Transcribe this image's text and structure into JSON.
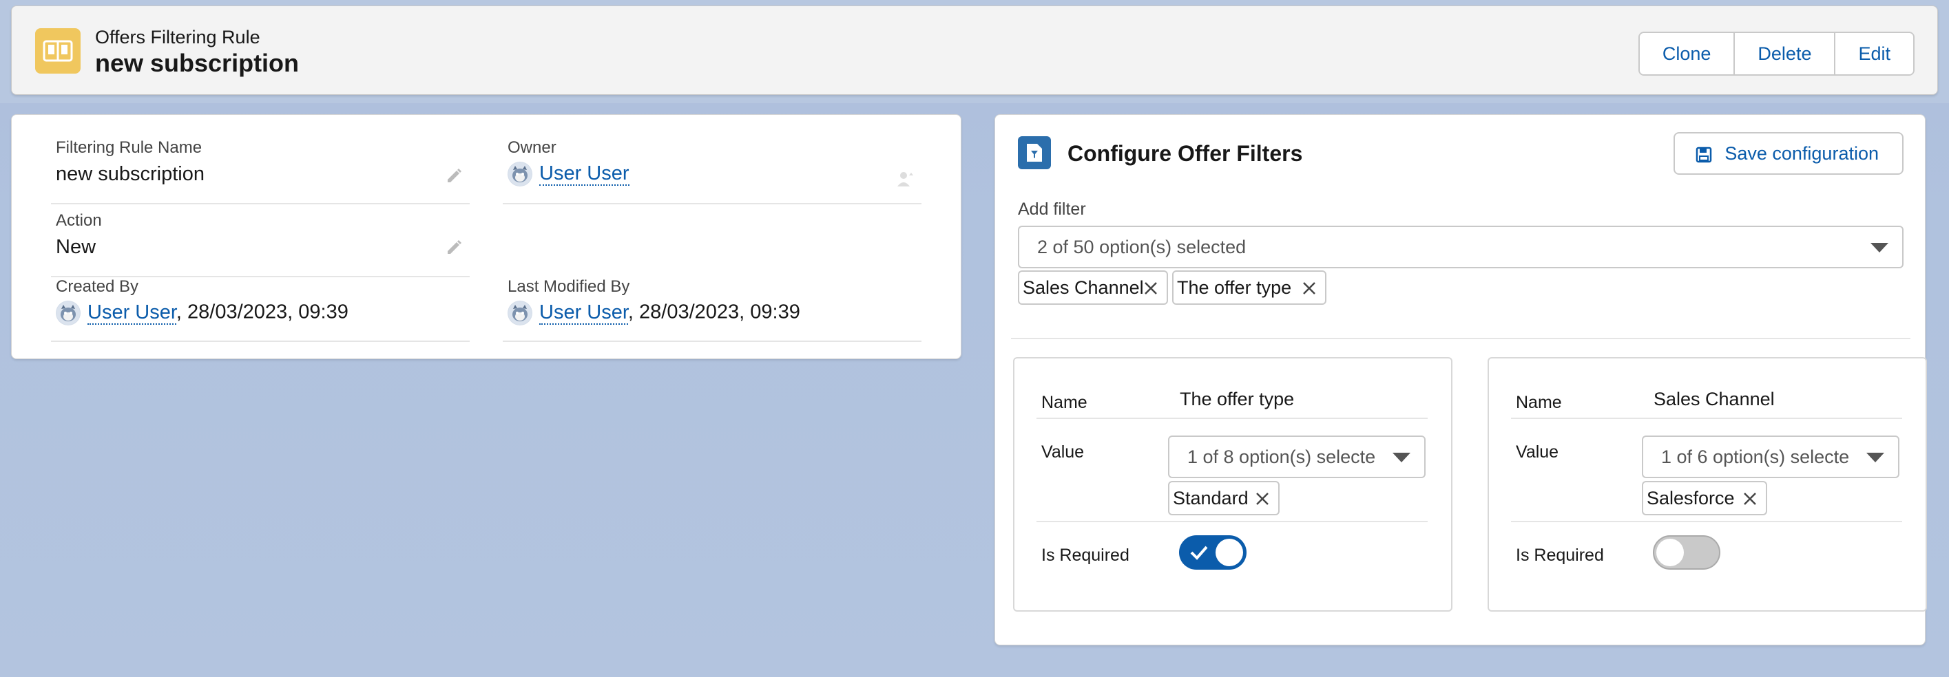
{
  "header": {
    "object_label": "Offers Filtering Rule",
    "record_title": "new subscription",
    "buttons": [
      "Clone",
      "Delete",
      "Edit"
    ]
  },
  "details": {
    "filtering_rule_name": {
      "label": "Filtering Rule Name",
      "value": "new subscription"
    },
    "owner": {
      "label": "Owner",
      "value": "User User"
    },
    "action": {
      "label": "Action",
      "value": "New"
    },
    "created_by": {
      "label": "Created By",
      "user": "User User",
      "date": ", 28/03/2023, 09:39"
    },
    "last_modified_by": {
      "label": "Last Modified By",
      "user": "User User",
      "date": ", 28/03/2023, 09:39"
    }
  },
  "config": {
    "title": "Configure Offer Filters",
    "save_label": "Save configuration",
    "add_filter_label": "Add filter",
    "add_filter_value": "2 of 50 option(s) selected",
    "selected_filters": [
      "Sales Channel",
      "The offer type"
    ],
    "filters": [
      {
        "name_label": "Name",
        "name": "The offer type",
        "value_label": "Value",
        "value_combo": "1 of 8 option(s) selecte",
        "selected_values": [
          "Standard"
        ],
        "required_label": "Is Required",
        "is_required": true
      },
      {
        "name_label": "Name",
        "name": "Sales Channel",
        "value_label": "Value",
        "value_combo": "1 of 6 option(s) selecte",
        "selected_values": [
          "Salesforce"
        ],
        "required_label": "Is Required",
        "is_required": false
      }
    ]
  },
  "icons": {
    "header": "filter-rule-book-icon",
    "config": "document-filter-icon",
    "save": "save-disk-icon",
    "edit": "pencil-icon",
    "owner_change": "change-owner-icon",
    "remove": "close-icon",
    "dropdown": "chevron-down-icon"
  },
  "colors": {
    "brand": "#0b5cab",
    "header_icon": "#f0c75e",
    "config_icon": "#2b6eac"
  }
}
